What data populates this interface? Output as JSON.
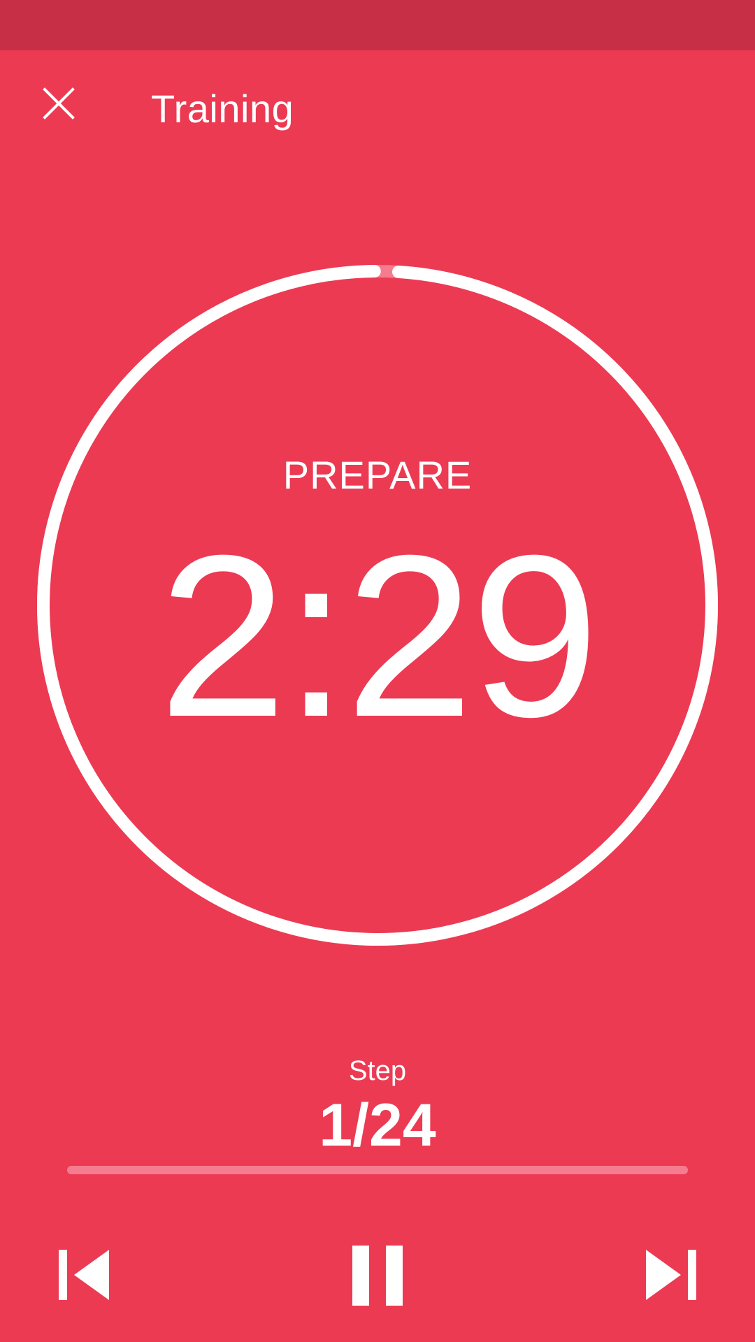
{
  "app_bar": {
    "title": "Training",
    "close_icon": "close-icon"
  },
  "timer": {
    "phase": "PREPARE",
    "time": "2:29",
    "ring_progress": 0.01
  },
  "step": {
    "caption": "Step",
    "value": "1/24",
    "progress": 0.0
  },
  "controls": {
    "previous_icon": "skip-previous-icon",
    "pause_icon": "pause-icon",
    "next_icon": "skip-next-icon"
  },
  "colors": {
    "background": "#ec3a53",
    "status_bar": "#c72f46",
    "track": "#f57c8e",
    "foreground": "#ffffff"
  }
}
